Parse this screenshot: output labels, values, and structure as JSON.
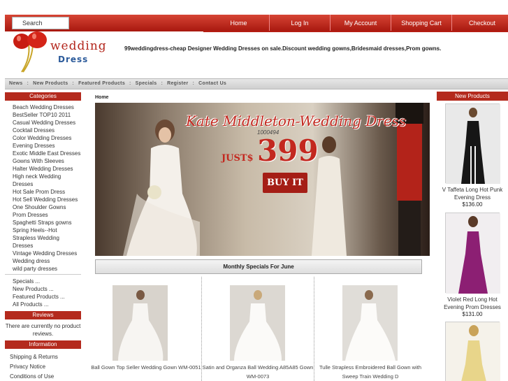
{
  "topbar": {
    "search_label": "Search",
    "nav": [
      "Home",
      "Log In",
      "My Account",
      "Shopping Cart",
      "Checkout"
    ]
  },
  "header": {
    "logo_word1": "wedding",
    "logo_word2": "Dress",
    "tagline": "99weddingdress-cheap Designer Wedding Dresses on sale.Discount wedding gowns,Bridesmaid dresses,Prom gowns."
  },
  "submenu": [
    "News",
    "New Products",
    "Featured Products",
    "Specials",
    "Register",
    "Contact Us"
  ],
  "sidebar": {
    "categories_title": "Categories",
    "categories": [
      "Beach Wedding Dresses",
      "BestSeller TOP10 2011",
      "Casual Wedding Dresses",
      "Cocktail Dresses",
      "Color Wedding Dresses",
      "Evening Dresses",
      "Exotic Middle East Dresses",
      "Gowns With Sleeves",
      "Halter Wedding Dresses",
      "High neck Wedding",
      "Dresses",
      "Hot Sale Prom Dress",
      "Hot Sell Wedding Dresses",
      "One Shoulder Gowns",
      "Prom Dresses",
      "Spaghetti Straps gowns",
      "Spring Heels--Hot",
      "Strapless Wedding",
      "Dresses",
      "Vintage Wedding Dresses",
      "Wedding dress",
      "wild party dresses"
    ],
    "extra_links": [
      "Specials ...",
      "New Products ...",
      "Featured Products ...",
      "All Products ..."
    ],
    "reviews_title": "Reviews",
    "reviews_text": "There are currently no product reviews.",
    "information_title": "Information",
    "information_links": [
      "Shipping & Returns",
      "Privacy Notice",
      "Conditions of Use"
    ]
  },
  "main": {
    "breadcrumb": "Home",
    "banner": {
      "title": "Kate Middleton-Wedding Dress",
      "code": "1000494",
      "price_prefix": "JUST$",
      "price": "399",
      "buy_label": "BUY IT"
    },
    "monthly_title": "Monthly Specials For June",
    "products": [
      {
        "name": "Ball Gown Top Seller Wedding Gown WM-0051"
      },
      {
        "name": "Satin and Organza Ball Wedding A85A85 Gown WM-0073"
      },
      {
        "name": "Tulle Strapless Embroidered Ball Gown with Sweep Train Wedding D"
      }
    ]
  },
  "right": {
    "title": "New Products",
    "products": [
      {
        "name": "V Taffeta Long Hot Punk Evening Dress",
        "price": "$136.00"
      },
      {
        "name": "Violet Red Long Hot Evening Prom Dresses",
        "price": "$131.00"
      }
    ]
  },
  "colors": {
    "accent_red": "#b42a1d",
    "logo_blue": "#2c5b9b"
  }
}
